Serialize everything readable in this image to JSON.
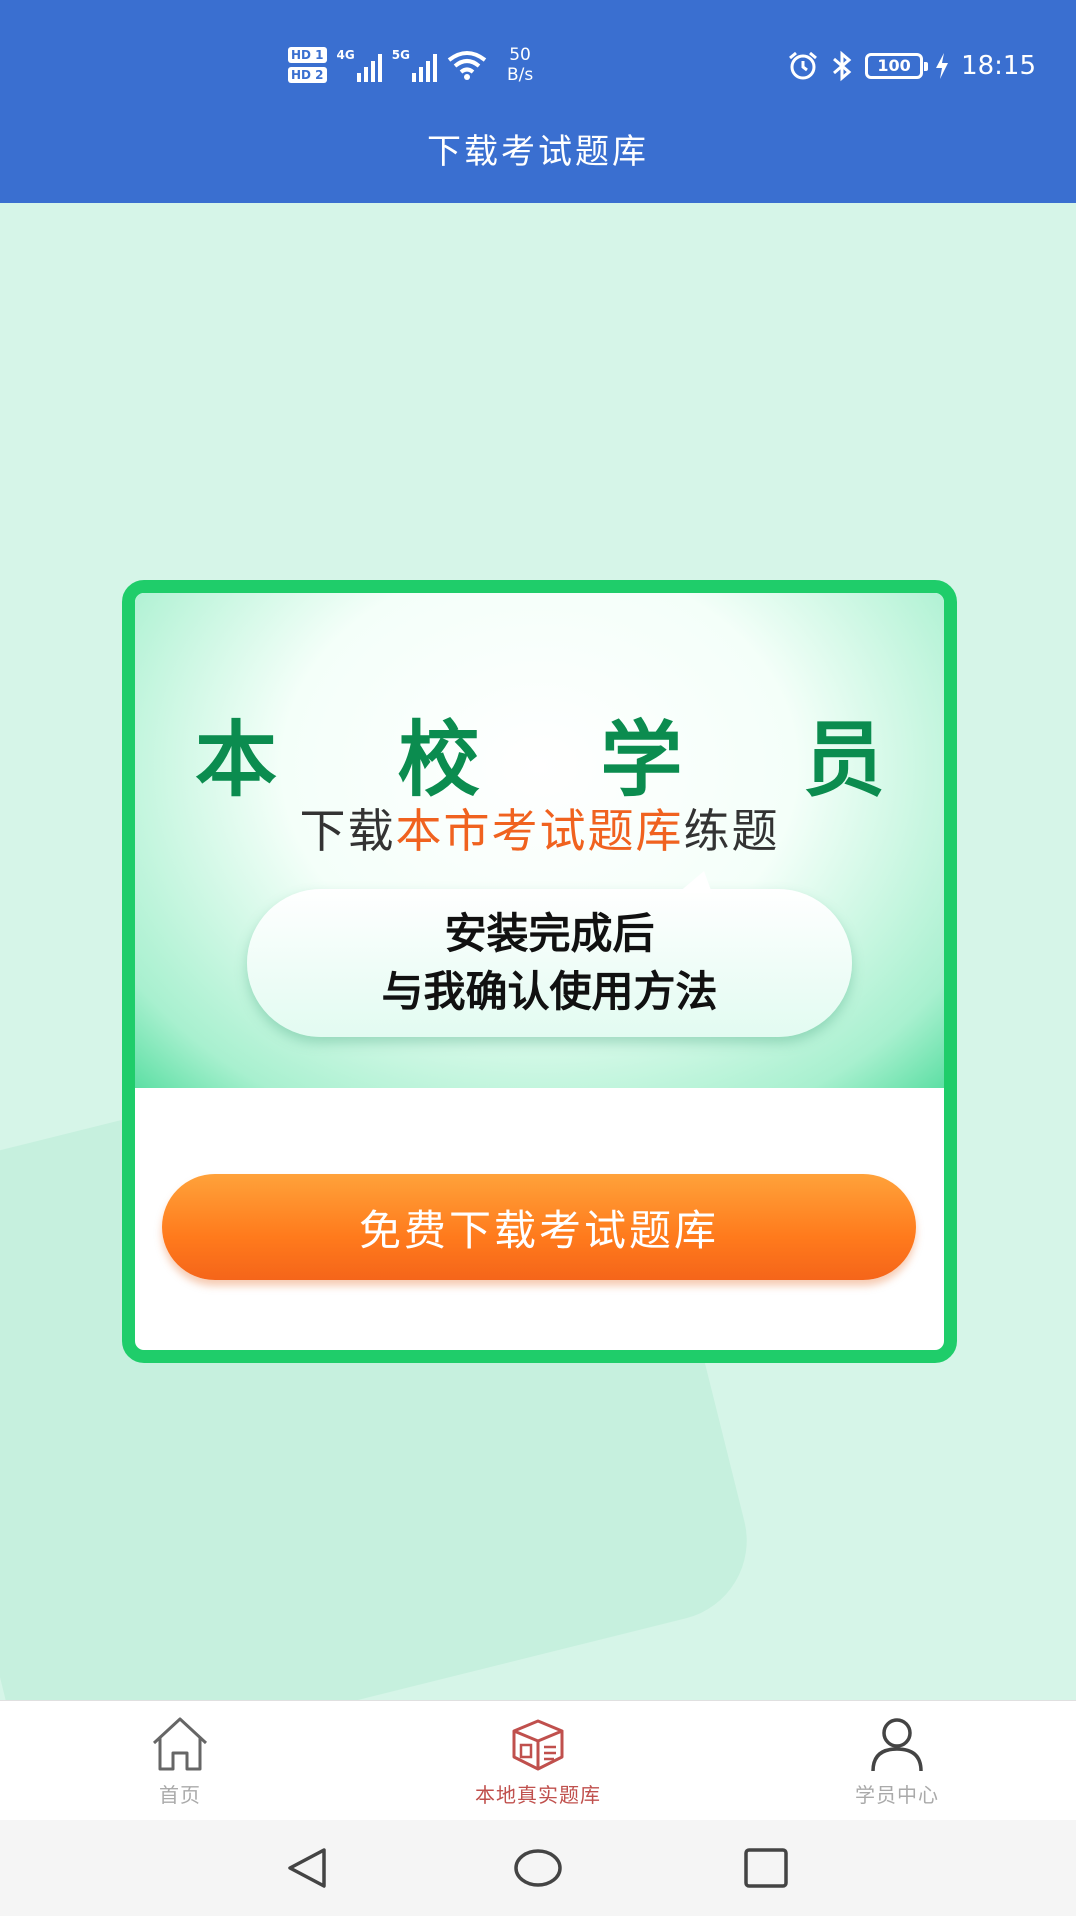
{
  "status_bar": {
    "hd1": "HD 1",
    "hd2": "HD 2",
    "net1": "4G",
    "net2": "5G",
    "speed_value": "50",
    "speed_unit": "B/s",
    "battery": "100",
    "time": "18:15"
  },
  "header": {
    "title": "下载考试题库"
  },
  "card": {
    "big_title": [
      "本",
      "校",
      "学",
      "员"
    ],
    "subtitle_prefix": "下载",
    "subtitle_highlight": "本市考试题库",
    "subtitle_suffix": "练题",
    "bubble_line1": "安装完成后",
    "bubble_line2": "与我确认使用方法",
    "button_label": "免费下载考试题库"
  },
  "tabbar": {
    "items": [
      {
        "label": "首页",
        "icon": "home-icon",
        "active": false
      },
      {
        "label": "本地真实题库",
        "icon": "box-icon",
        "active": true
      },
      {
        "label": "学员中心",
        "icon": "user-icon",
        "active": false
      }
    ]
  },
  "colors": {
    "header": "#3a6fd0",
    "background": "#d6f5e8",
    "card_border": "#1fcd6a",
    "title_green": "#0b8c4f",
    "highlight_orange": "#f0621f",
    "button_orange": "#ff7a1c",
    "active_tab": "#c0504d"
  }
}
